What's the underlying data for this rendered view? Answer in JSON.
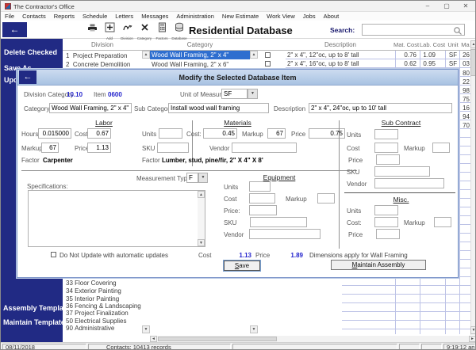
{
  "window": {
    "title": "The Contractor's Office",
    "controls": {
      "minimize": "–",
      "maximize": "▢",
      "close": "✕"
    }
  },
  "menu": {
    "items": [
      "File",
      "Contacts",
      "Reports",
      "Schedule",
      "Letters",
      "Messages",
      "Administration",
      "New Estimate",
      "Work View",
      "Jobs",
      "About"
    ]
  },
  "toolbar": {
    "title": "Residential Database",
    "search_label": "Search:",
    "icon_labels": {
      "add": "Add",
      "division": "Division",
      "category": "Category",
      "factors": "Factors",
      "database": "Database"
    }
  },
  "sidebar": {
    "delete_checked": "Delete Checked",
    "save_as": "Save As",
    "update_partial": "Upda",
    "assembly_templates": "Assembly Templates",
    "maintain_templates": "Maintain Templates"
  },
  "table": {
    "headers": {
      "division": "Division",
      "category": "Category",
      "description": "Description",
      "mat_cost": "Mat. Cost",
      "lab_cost": "Lab. Cost",
      "unit": "Unit",
      "markup": "Ma"
    },
    "divisions_top": [
      {
        "num": "1",
        "name": "Project Preparation"
      },
      {
        "num": "2",
        "name": "Concrete Demolition"
      }
    ],
    "categories": [
      {
        "name": "Wood Wall Framing, 2\" x 4\""
      },
      {
        "name": "Wood Wall Framing, 2\" x 6\""
      }
    ],
    "items": [
      {
        "description": "2\" x 4\", 12\"oc, up to 8' tall",
        "mat_cost": "0.76",
        "lab_cost": "1.09",
        "unit": "SF",
        "markup": "26"
      },
      {
        "description": "2\" x 4\", 16\"oc, up to 8' tall",
        "mat_cost": "0.62",
        "lab_cost": "0.95",
        "unit": "SF",
        "markup": "03"
      }
    ],
    "markup_column_partial": [
      "80",
      "22",
      "98",
      "75",
      "16",
      "94",
      "70"
    ],
    "divisions_bottom": [
      {
        "num": "33",
        "name": "Floor Covering"
      },
      {
        "num": "34",
        "name": "Exterior Painting"
      },
      {
        "num": "35",
        "name": "Interior Painting"
      },
      {
        "num": "36",
        "name": "Fencing & Landscaping"
      },
      {
        "num": "37",
        "name": "Project Finalization"
      },
      {
        "num": "50",
        "name": "Electrical Supplies"
      },
      {
        "num": "90",
        "name": "Administrative"
      }
    ]
  },
  "modal": {
    "title": "Modify the Selected Database Item",
    "division_category_label": "Division Category",
    "division_category_value": "10.10",
    "item_label": "Item",
    "item_value": "0600",
    "unit_of_measure_label": "Unit of Measure",
    "unit_of_measure_value": "SF",
    "category_label": "Category",
    "category_value": "Wood Wall Framing, 2\" x 4\"",
    "sub_category_label": "Sub Category",
    "sub_category_value": "Install wood wall framing",
    "description_label": "Description",
    "description_value": "2\" x 4\", 24\"oc, up to 10' tall",
    "labor": {
      "title": "Labor",
      "hours_label": "Hours",
      "hours": "0.015000",
      "cost_label": "Cost",
      "cost": "0.67",
      "markup_label": "Markup",
      "markup": "67",
      "price_label": "Price",
      "price": "1.13",
      "factor_label": "Factor",
      "factor": "Carpenter"
    },
    "materials": {
      "title": "Materials",
      "units_label": "Units",
      "cost_label": "Cost:",
      "cost": "0.45",
      "markup_label": "Markup",
      "markup": "67",
      "price_label": "Price",
      "price": "0.75",
      "sku_label": "SKU",
      "vendor_label": "Vendor",
      "factor_label": "Factor",
      "factor": "Lumber, stud, pine/fir, 2\" X 4\" X 8'"
    },
    "measurement_type_label": "Measurement Type:",
    "measurement_type_value": "F",
    "specifications_label": "Specifications:",
    "equipment": {
      "title": "Equipment",
      "units_label": "Units",
      "cost_label": "Cost",
      "markup_label": "Markup",
      "price_label": "Price:",
      "sku_label": "SKU",
      "vendor_label": "Vendor"
    },
    "sub_contract": {
      "title": "Sub Contract",
      "units_label": "Units",
      "cost_label": "Cost",
      "markup_label": "Markup",
      "price_label": "Price",
      "sku_label": "SKU",
      "vendor_label": "Vendor"
    },
    "misc": {
      "title": "Misc.",
      "units_label": "Units",
      "cost_label": "Cost:",
      "markup_label": "Markup",
      "price_label": "Price"
    },
    "do_not_update_label": "Do Not Update with automatic updates",
    "totals": {
      "cost_label": "Cost",
      "cost": "1.13",
      "price_label": "Price",
      "price": "1.89"
    },
    "dimensions_note": "Dimensions apply for Wall Framing",
    "save_button": "Save",
    "maintain_assembly_button": "Maintain Assembly"
  },
  "statusbar": {
    "date": "08/11/2018",
    "contacts": "Contacts: 10413 records",
    "time": "9:19:12 am"
  }
}
